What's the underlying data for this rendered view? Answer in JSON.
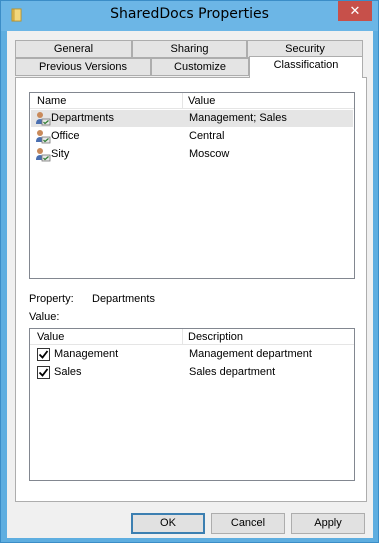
{
  "window": {
    "title": "SharedDocs Properties",
    "close_glyph": "✕",
    "accent_color": "#6cb6e6"
  },
  "tabs": {
    "row_top": [
      "General",
      "Sharing",
      "Security"
    ],
    "row_bottom": [
      "Previous Versions",
      "Customize",
      "Classification"
    ],
    "active": "Classification"
  },
  "properties_list": {
    "columns": [
      "Name",
      "Value"
    ],
    "rows": [
      {
        "name": "Departments",
        "value": "Management; Sales",
        "selected": true
      },
      {
        "name": "Office",
        "value": "Central",
        "selected": false
      },
      {
        "name": "Sity",
        "value": "Moscow",
        "selected": false
      }
    ]
  },
  "property": {
    "label": "Property:",
    "value": "Departments",
    "value_label": "Value:"
  },
  "values_list": {
    "columns": [
      "Value",
      "Description"
    ],
    "rows": [
      {
        "value": "Management",
        "description": "Management department",
        "checked": true
      },
      {
        "value": "Sales",
        "description": "Sales department",
        "checked": true
      }
    ]
  },
  "buttons": {
    "ok": "OK",
    "cancel": "Cancel",
    "apply": "Apply"
  }
}
